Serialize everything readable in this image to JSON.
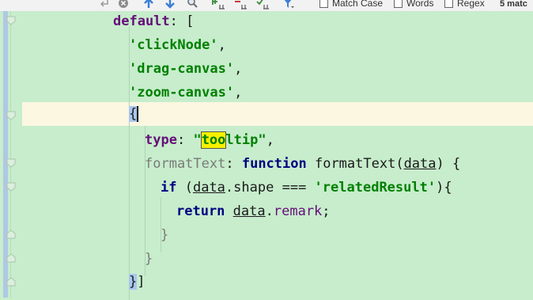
{
  "search_bar": {
    "icons": [
      "return-arrow-icon",
      "clear-search-icon",
      "arrow-up-icon",
      "arrow-down-icon",
      "find-all-icon",
      "add-selection-icon",
      "remove-selection-icon",
      "select-all-occurrences-icon",
      "filter-icon"
    ],
    "options": [
      {
        "label": "Match Case",
        "checked": false
      },
      {
        "label": "Words",
        "checked": false
      },
      {
        "label": "Regex",
        "checked": false
      }
    ],
    "match_count": "5 matc"
  },
  "code": {
    "line1": {
      "prop": "default",
      "colon": ": ["
    },
    "line2": {
      "q_open": "'",
      "str": "clickNode",
      "q_close": "'",
      "comma": ","
    },
    "line3": {
      "q_open": "'",
      "str": "drag-canvas",
      "q_close": "'",
      "comma": ","
    },
    "line4": {
      "q_open": "'",
      "str": "zoom-canvas",
      "q_close": "'",
      "comma": ","
    },
    "line5": {
      "brace": "{"
    },
    "line6": {
      "prop": "type",
      "colon": ": ",
      "q_open": "\"",
      "match": "too",
      "rest": "ltip",
      "q_close": "\"",
      "comma": ","
    },
    "line7": {
      "prop": "formatText",
      "colon": ": ",
      "kw": "function",
      "name": " formatText(",
      "param": "data",
      "tail": ") {"
    },
    "line8": {
      "kw": "if",
      "open": " (",
      "obj": "data",
      "dot": ".",
      "prop": "shape",
      "op": " === ",
      "q_open": "'",
      "str": "relatedResult",
      "q_close": "'",
      "tail": "){"
    },
    "line9": {
      "kw": "return",
      "space": " ",
      "obj": "data",
      "dot": ".",
      "prop": "remark",
      "semi": ";"
    },
    "line10": {
      "brace": "}"
    },
    "line11": {
      "brace": "}"
    },
    "line12": {
      "brace": "}",
      "bracket": "]"
    }
  },
  "colors": {
    "editor_background": "#c7edcc",
    "current_line": "#fbf7e1",
    "search_match": "#f8f000",
    "brace_match": "#a9c6ee",
    "keyword": "#000080",
    "string": "#008000",
    "property": "#660e7a"
  }
}
